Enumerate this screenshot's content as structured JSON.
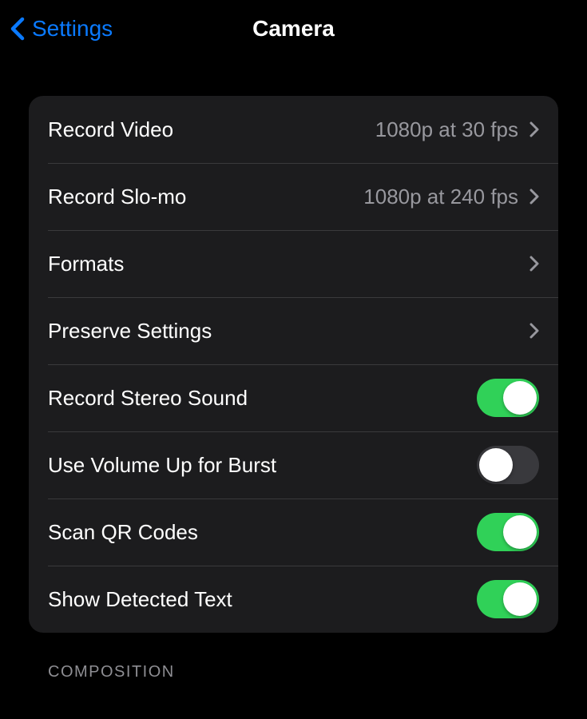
{
  "nav": {
    "back_label": "Settings",
    "title": "Camera"
  },
  "rows": [
    {
      "label": "Record Video",
      "detail": "1080p at 30 fps",
      "type": "link"
    },
    {
      "label": "Record Slo-mo",
      "detail": "1080p at 240 fps",
      "type": "link"
    },
    {
      "label": "Formats",
      "detail": "",
      "type": "link"
    },
    {
      "label": "Preserve Settings",
      "detail": "",
      "type": "link"
    },
    {
      "label": "Record Stereo Sound",
      "type": "toggle",
      "on": true
    },
    {
      "label": "Use Volume Up for Burst",
      "type": "toggle",
      "on": false
    },
    {
      "label": "Scan QR Codes",
      "type": "toggle",
      "on": true
    },
    {
      "label": "Show Detected Text",
      "type": "toggle",
      "on": true
    }
  ],
  "section_header": "COMPOSITION"
}
